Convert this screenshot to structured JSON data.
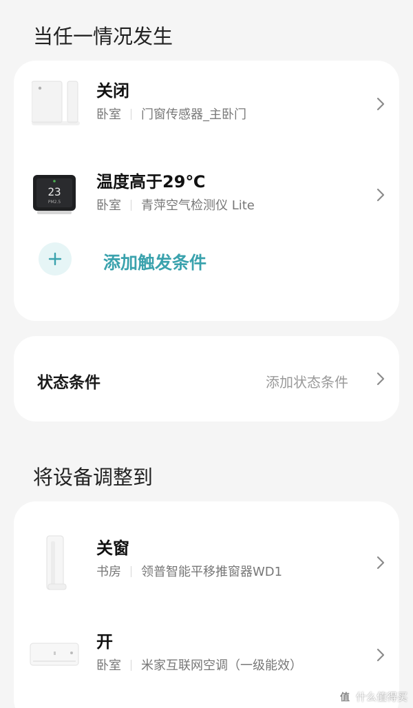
{
  "trigger_section": {
    "title": "当任一情况发生",
    "items": [
      {
        "title": "关闭",
        "room": "卧室",
        "device": "门窗传感器_主卧门",
        "icon": "door-sensor-icon"
      },
      {
        "title": "温度高于29℃",
        "room": "卧室",
        "device": "青萍空气检测仪 Lite",
        "icon": "air-monitor-icon",
        "screen_reading": "23",
        "screen_unit": "PM2.5"
      }
    ],
    "add_label": "添加触发条件",
    "add_symbol": "+"
  },
  "state_section": {
    "title": "状态条件",
    "action": "添加状态条件"
  },
  "action_section": {
    "title": "将设备调整到",
    "items": [
      {
        "title": "关窗",
        "room": "书房",
        "device": "领普智能平移推窗器WD1",
        "icon": "window-pusher-icon"
      },
      {
        "title": "开",
        "room": "卧室",
        "device": "米家互联网空调（一级能效）",
        "icon": "air-conditioner-icon"
      }
    ]
  },
  "watermark": {
    "badge": "值",
    "text": "什么值得买"
  },
  "colors": {
    "accent": "#3aa2ad",
    "add_bg": "#e6f5f6",
    "background": "#f5f5f5",
    "card": "#ffffff"
  }
}
